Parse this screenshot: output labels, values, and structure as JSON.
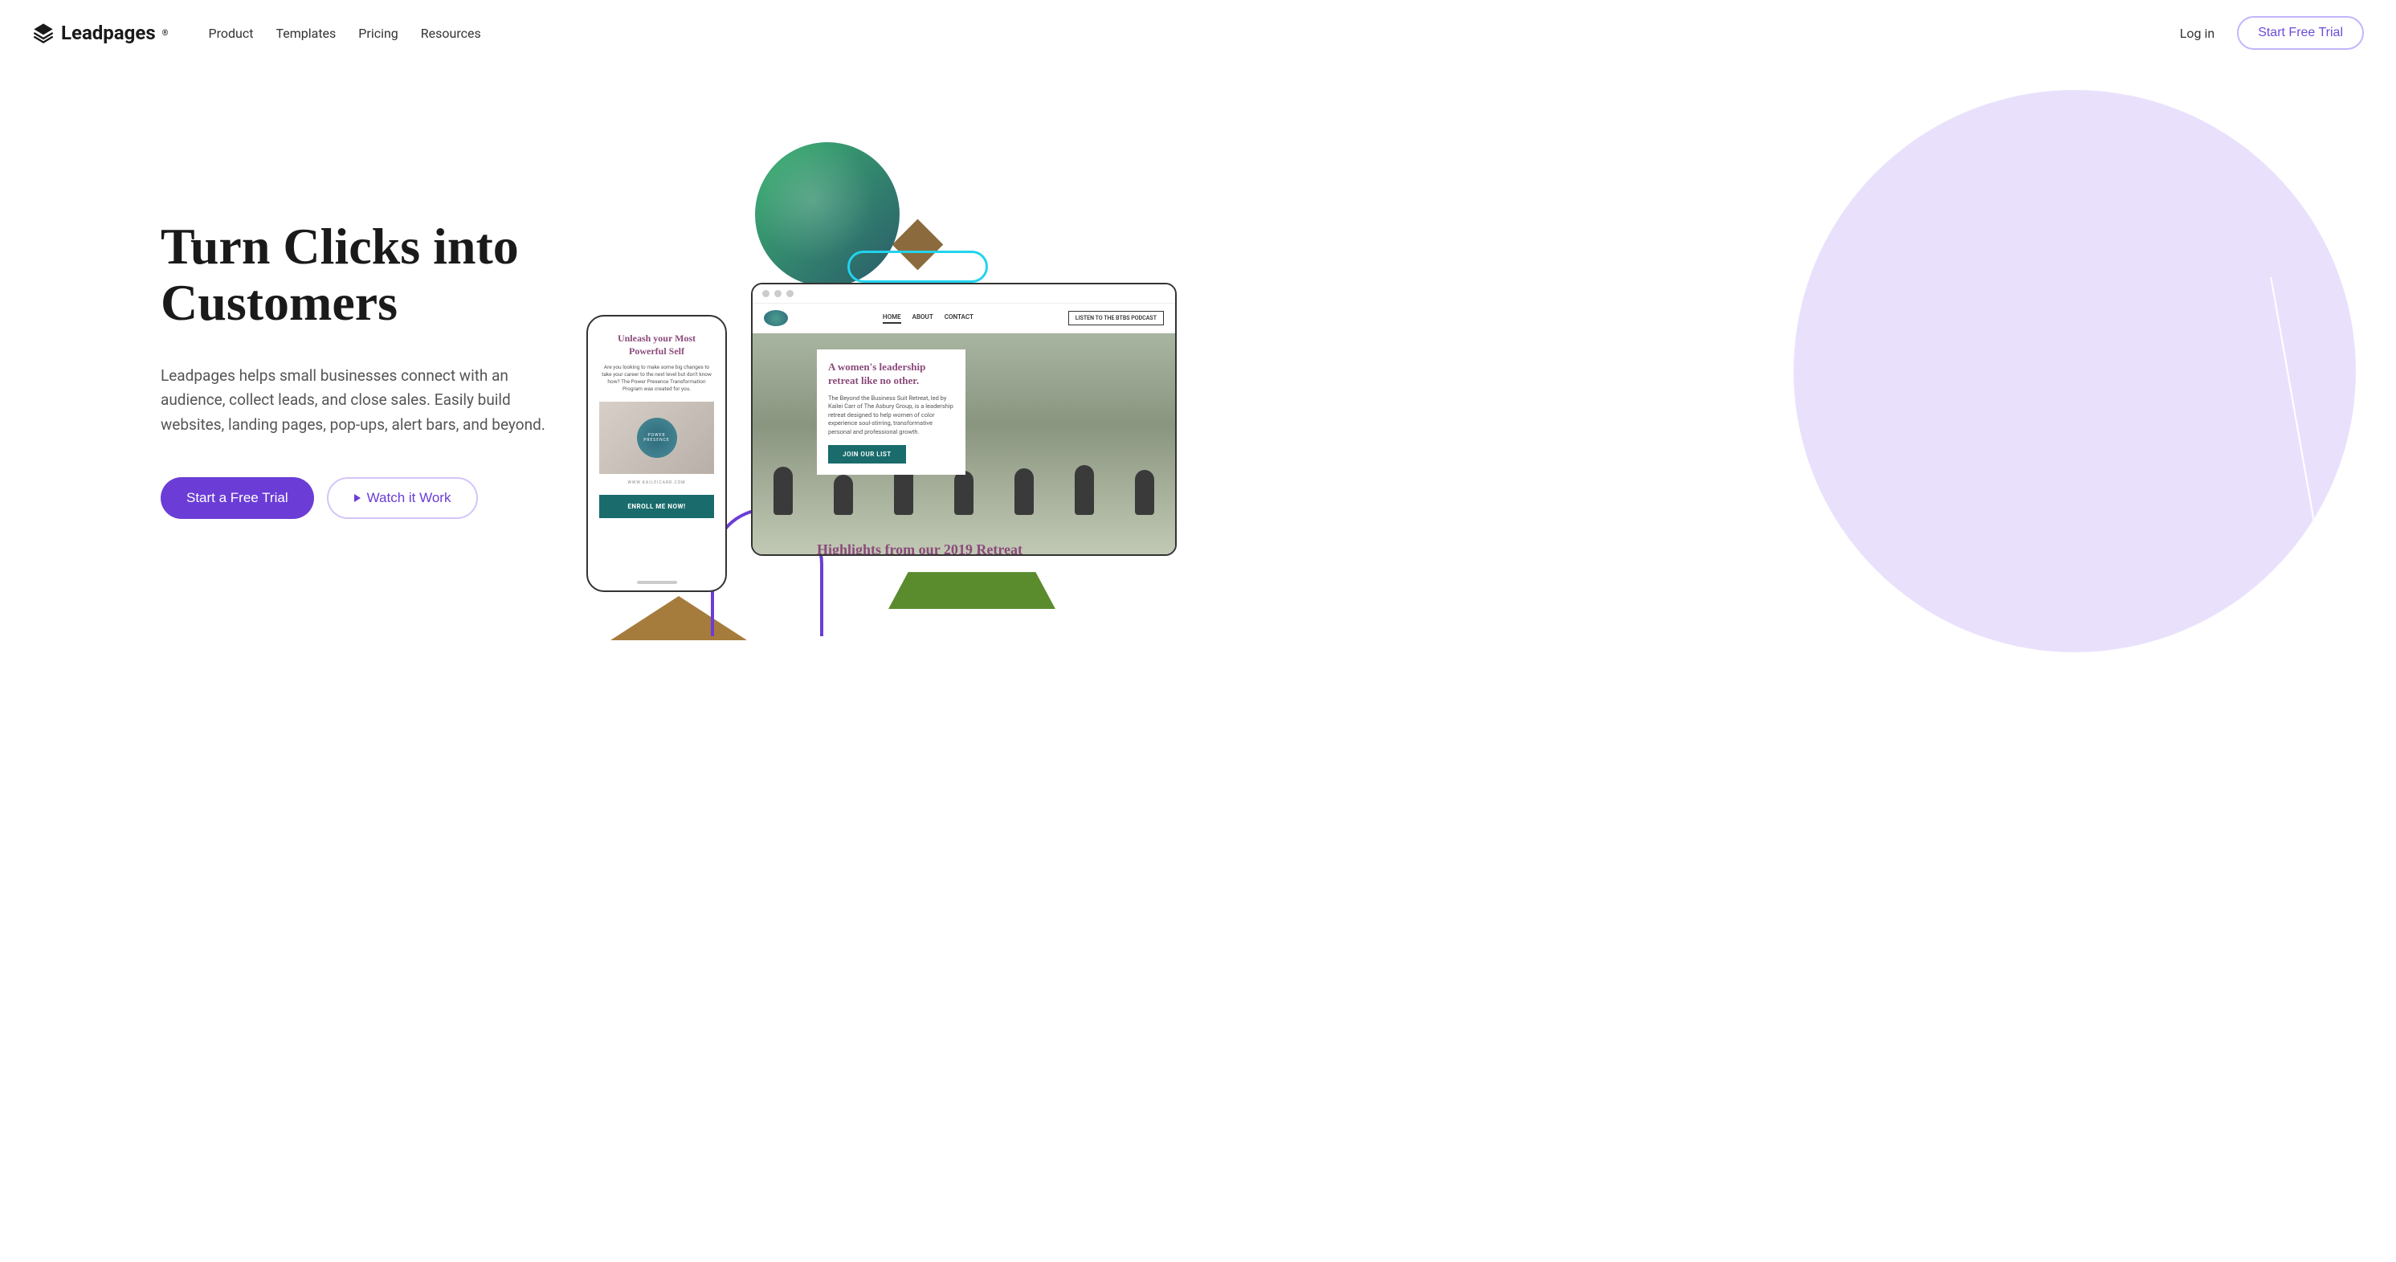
{
  "brand": "Leadpages",
  "nav": {
    "product": "Product",
    "templates": "Templates",
    "pricing": "Pricing",
    "resources": "Resources"
  },
  "header": {
    "login": "Log in",
    "trial": "Start Free Trial"
  },
  "hero": {
    "title": "Turn Clicks into Customers",
    "description": "Leadpages helps small businesses connect with an audience, collect leads, and close sales. Easily build websites, landing pages, pop-ups, alert bars, and beyond.",
    "primaryCta": "Start a Free Trial",
    "secondaryCta": "Watch it Work"
  },
  "mockup": {
    "browser": {
      "navHome": "HOME",
      "navAbout": "ABOUT",
      "navContact": "CONTACT",
      "navButton": "LISTEN TO THE BTBS PODCAST",
      "cardTitle": "A women's leadership retreat like no other.",
      "cardText": "The Beyond the Business Suit Retreat, led by Kailei Carr of The Asbury Group, is a leadership retreat designed to help women of color experience soul-stirring, transformative personal and professional growth.",
      "cardButton": "JOIN OUR LIST",
      "highlights": "Highlights from our 2019 Retreat"
    },
    "mobile": {
      "title": "Unleash your Most Powerful Self",
      "text": "Are you looking to make some big changes to take your career to the next level but don't know how? The Power Presence Transformation Program was created for you.",
      "badgeLine1": "POWER",
      "badgeLine2": "PRESENCE",
      "url": "WWW.KAILEICARR.COM",
      "button": "ENROLL ME NOW!"
    }
  }
}
